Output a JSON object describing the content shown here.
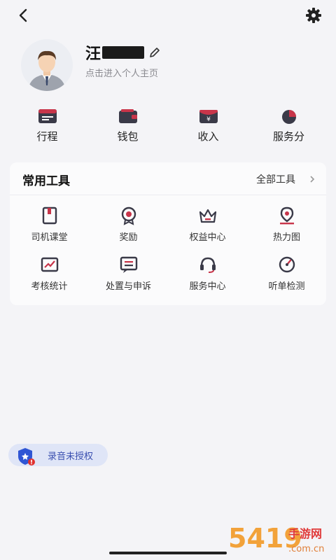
{
  "profile": {
    "name": "汪",
    "subtitle": "点击进入个人主页"
  },
  "quick_actions": [
    {
      "label": "行程",
      "icon": "itinerary-icon"
    },
    {
      "label": "钱包",
      "icon": "wallet-icon"
    },
    {
      "label": "收入",
      "icon": "income-icon"
    },
    {
      "label": "服务分",
      "icon": "service-score-icon"
    }
  ],
  "tools": {
    "title": "常用工具",
    "all_label": "全部工具",
    "items": [
      {
        "label": "司机课堂",
        "icon": "book-icon"
      },
      {
        "label": "奖励",
        "icon": "medal-icon"
      },
      {
        "label": "权益中心",
        "icon": "crown-icon"
      },
      {
        "label": "热力图",
        "icon": "map-pin-icon"
      },
      {
        "label": "考核统计",
        "icon": "chart-icon"
      },
      {
        "label": "处置与申诉",
        "icon": "message-icon"
      },
      {
        "label": "服务中心",
        "icon": "headset-icon"
      },
      {
        "label": "听单检测",
        "icon": "gauge-icon"
      }
    ]
  },
  "recording_badge": {
    "label": "录音未授权",
    "icon": "shield-icon"
  },
  "watermark": {
    "text": "5419",
    "sub": "手游网",
    "domain": ".com.cn"
  },
  "colors": {
    "accent": "#c8354a",
    "icon_dark": "#3a3a48",
    "badge_bg": "#dfe5f7",
    "badge_text": "#3a4fb0"
  }
}
